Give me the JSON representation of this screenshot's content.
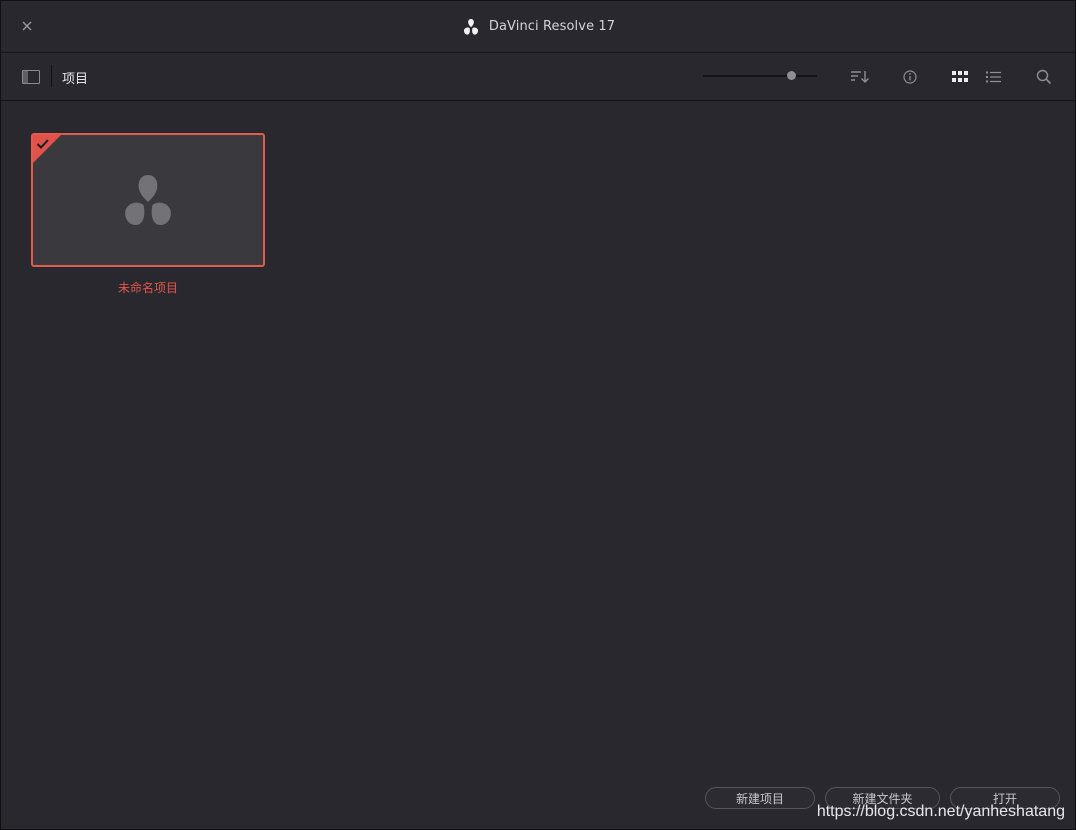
{
  "window": {
    "title": "DaVinci Resolve 17"
  },
  "toolbar": {
    "breadcrumb": "项目",
    "zoom_level": 0.8,
    "icons": [
      "sidebar-toggle-icon",
      "sort-icon",
      "info-icon",
      "grid-view-icon",
      "list-view-icon",
      "search-icon"
    ]
  },
  "projects": [
    {
      "name": "未命名项目",
      "selected": true
    }
  ],
  "buttons": {
    "new_project": "新建项目",
    "new_folder": "新建文件夹",
    "open": "打开"
  },
  "watermark": "https://blog.csdn.net/yanheshatang",
  "colors": {
    "accent": "#e2574c",
    "background": "#28282e",
    "thumbnail": "#39393e"
  }
}
